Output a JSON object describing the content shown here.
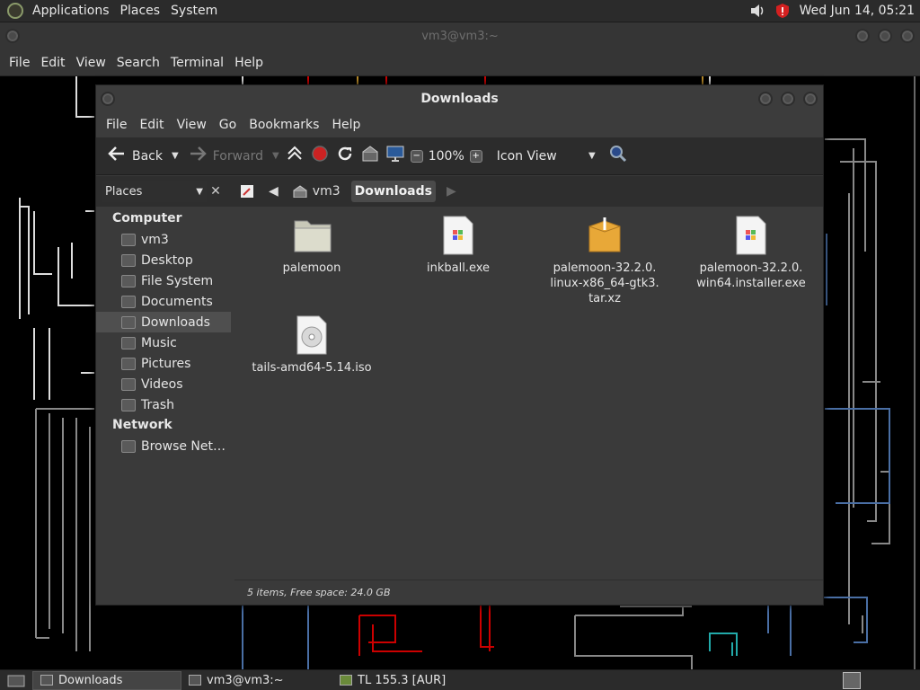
{
  "top_panel": {
    "menus": [
      "Applications",
      "Places",
      "System"
    ],
    "clock": "Wed Jun 14, 05:21",
    "tray_icons": [
      "volume-icon",
      "shield-icon"
    ]
  },
  "terminal": {
    "title": "vm3@vm3:~",
    "menus": [
      "File",
      "Edit",
      "View",
      "Search",
      "Terminal",
      "Help"
    ]
  },
  "file_manager": {
    "title": "Downloads",
    "menus": [
      "File",
      "Edit",
      "View",
      "Go",
      "Bookmarks",
      "Help"
    ],
    "toolbar": {
      "back": "Back",
      "forward": "Forward",
      "zoom": "100%",
      "view_mode": "Icon View"
    },
    "places_label": "Places",
    "path": [
      "vm3",
      "Downloads"
    ],
    "sidebar": {
      "computer_heading": "Computer",
      "computer_items": [
        "vm3",
        "Desktop",
        "File System",
        "Documents",
        "Downloads",
        "Music",
        "Pictures",
        "Videos",
        "Trash"
      ],
      "selected": "Downloads",
      "network_heading": "Network",
      "network_items": [
        "Browse Net…"
      ]
    },
    "files": [
      {
        "name": "palemoon",
        "type": "folder"
      },
      {
        "name": "inkball.exe",
        "type": "exe"
      },
      {
        "name": "palemoon-32.2.0.\nlinux-x86_64-gtk3.\ntar.xz",
        "type": "archive"
      },
      {
        "name": "palemoon-32.2.0.\nwin64.installer.exe",
        "type": "exe"
      },
      {
        "name": "tails-amd64-5.14.iso",
        "type": "iso"
      }
    ],
    "status": "5 items, Free space: 24.0 GB"
  },
  "taskbar": {
    "tasks": [
      "Downloads",
      "vm3@vm3:~",
      "TL 155.3 [AUR]"
    ]
  }
}
